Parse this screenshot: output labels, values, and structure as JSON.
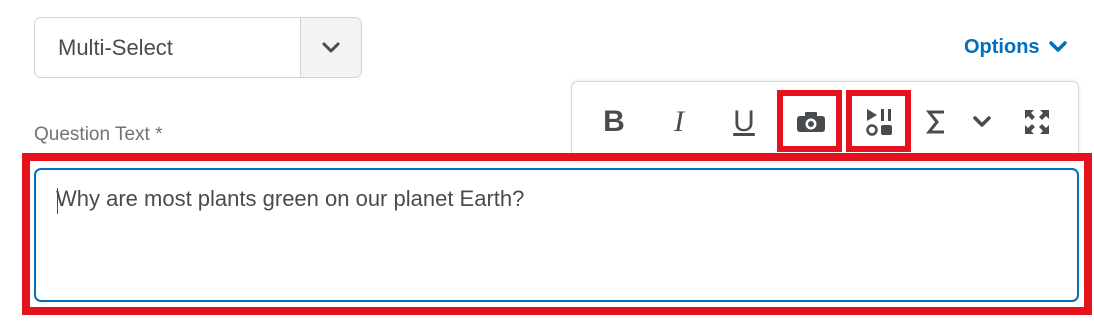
{
  "question_type_select": {
    "value": "Multi-Select",
    "caret_icon": "chevron-down-icon"
  },
  "options_link": {
    "label": "Options",
    "icon": "chevron-down-icon",
    "color": "#006fbf"
  },
  "question_text": {
    "label": "Question Text *",
    "value": "Why are most plants green on our planet Earth?"
  },
  "toolbar": {
    "bold_label": "B",
    "italic_label": "I",
    "underline_label": "U",
    "insert_image_icon": "camera-icon",
    "insert_media_icon": "media-icon",
    "equation_icon": "sigma-icon",
    "more_icon": "chevron-down-icon",
    "fullscreen_icon": "fullscreen-icon"
  },
  "colors": {
    "accent": "#006fbf",
    "highlight": "#e5111c",
    "text": "#494c4e"
  }
}
